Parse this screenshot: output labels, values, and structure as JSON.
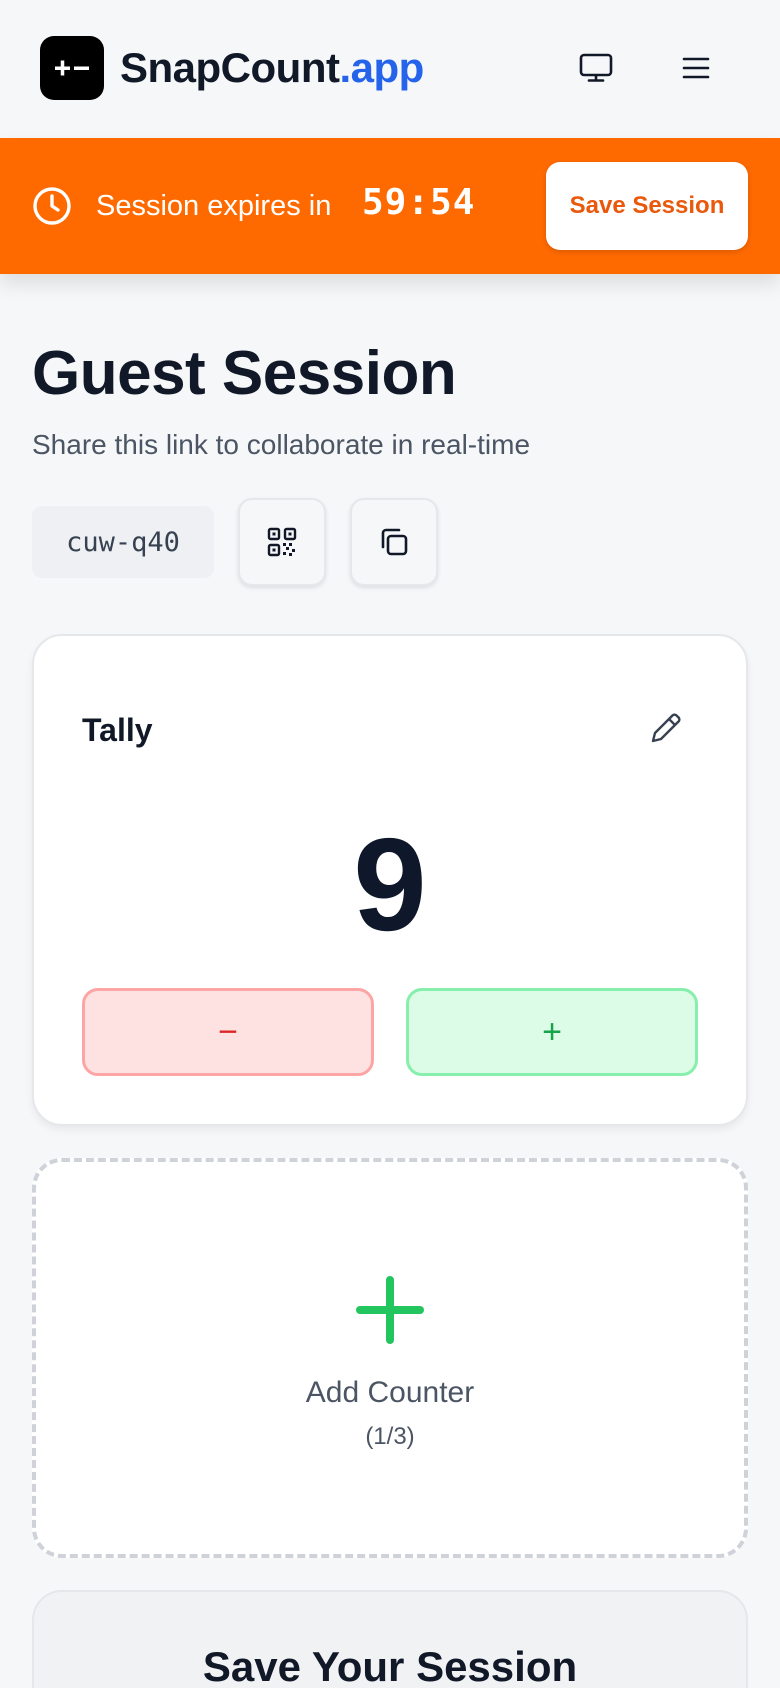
{
  "header": {
    "brand_main": "SnapCount",
    "brand_accent": ".app",
    "logo_glyph": "+−",
    "icons": [
      "monitor-icon",
      "menu-icon"
    ]
  },
  "banner": {
    "expires_label": "Session expires in",
    "timer": "59:54",
    "save_button_label": "Save Session",
    "icon": "clock-icon",
    "color": "#ff6a00"
  },
  "session": {
    "title": "Guest Session",
    "subtitle": "Share this link to collaborate in real-time",
    "code": "cuw-q40",
    "actions": [
      "qr-code-icon",
      "copy-icon"
    ]
  },
  "counter": {
    "name": "Tally",
    "value": "9",
    "decrement_label": "−",
    "increment_label": "+"
  },
  "add_counter": {
    "label": "Add Counter",
    "count": "(1/3)"
  },
  "save_section": {
    "title": "Save Your Session"
  },
  "colors": {
    "accent_blue": "#2563eb",
    "banner_orange": "#ff6a00",
    "decrement_red": "#dc2626",
    "increment_green": "#16a34a",
    "add_green": "#22c55e"
  }
}
